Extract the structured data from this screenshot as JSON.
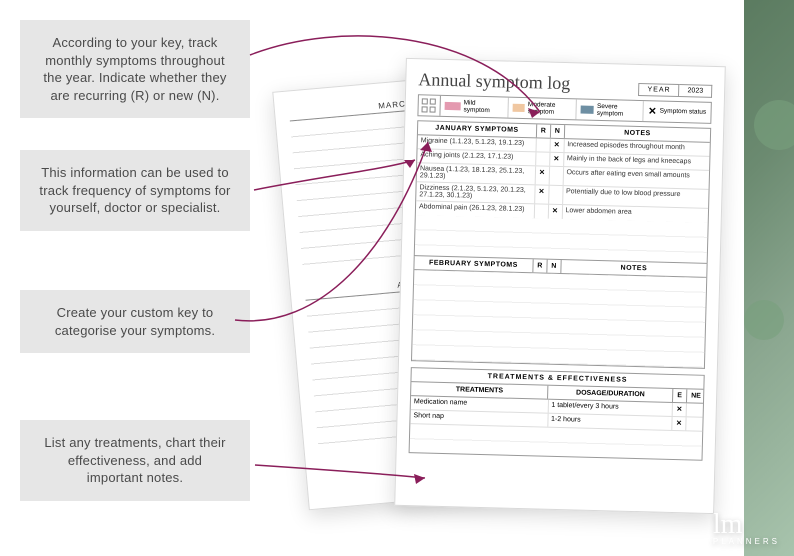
{
  "callouts": {
    "c1": "According to your key, track monthly symptoms throughout the year. Indicate whether they are recurring (R) or new (N).",
    "c2": "This information can be used to track frequency of symptoms for yourself, doctor or specialist.",
    "c3": "Create your custom key to categorise your symptoms.",
    "c4": "List any treatments, chart their effectiveness, and add important notes."
  },
  "back_page": {
    "sec1": "MARCH SYMPTOMS",
    "sec2": "APRIL SYMPTOMS"
  },
  "front_page": {
    "title": "Annual symptom log",
    "year_label": "YEAR",
    "year_value": "2023",
    "key": {
      "mild": {
        "label": "Mild symptom",
        "color": "#e49ab0"
      },
      "moderate": {
        "label": "Moderate symptom",
        "color": "#f0c7a1"
      },
      "severe": {
        "label": "Severe symptom",
        "color": "#6e8fa3"
      },
      "status": {
        "label": "Symptom status"
      }
    },
    "columns": {
      "r": "R",
      "n": "N",
      "notes": "NOTES"
    },
    "jan": {
      "header": "JANUARY SYMPTOMS",
      "rows": [
        {
          "name": "Migraine (1.1.23, 5.1.23, 19.1.23)",
          "r": "",
          "n": "✕",
          "notes": "Increased episodes throughout month"
        },
        {
          "name": "Aching joints (2.1.23, 17.1.23)",
          "r": "",
          "n": "✕",
          "notes": "Mainly in the back of legs and kneecaps"
        },
        {
          "name": "Nausea (1.1.23, 18.1.23, 25.1.23, 29.1.23)",
          "r": "✕",
          "n": "",
          "notes": "Occurs after eating even small amounts"
        },
        {
          "name": "Dizziness (2.1.23, 5.1.23, 20.1.23, 27.1.23, 30.1.23)",
          "r": "✕",
          "n": "",
          "notes": "Potentially due to low blood pressure"
        },
        {
          "name": "Abdominal pain (26.1.23, 28.1.23)",
          "r": "",
          "n": "✕",
          "notes": "Lower abdomen area"
        }
      ]
    },
    "feb": {
      "header": "FEBRUARY SYMPTOMS"
    },
    "treatments": {
      "title": "TREATMENTS & EFFECTIVENESS",
      "cols": {
        "name": "TREATMENTS",
        "dose": "DOSAGE/DURATION",
        "e": "E",
        "ne": "NE"
      },
      "rows": [
        {
          "name": "Medication name",
          "dose": "1 tablet/every 3 hours",
          "e": "✕",
          "ne": ""
        },
        {
          "name": "Short nap",
          "dose": "1-2 hours",
          "e": "✕",
          "ne": ""
        }
      ]
    }
  },
  "logo": {
    "mark": "lm",
    "sub": "PLANNERS"
  },
  "arrow_color": "#8a1e5a"
}
